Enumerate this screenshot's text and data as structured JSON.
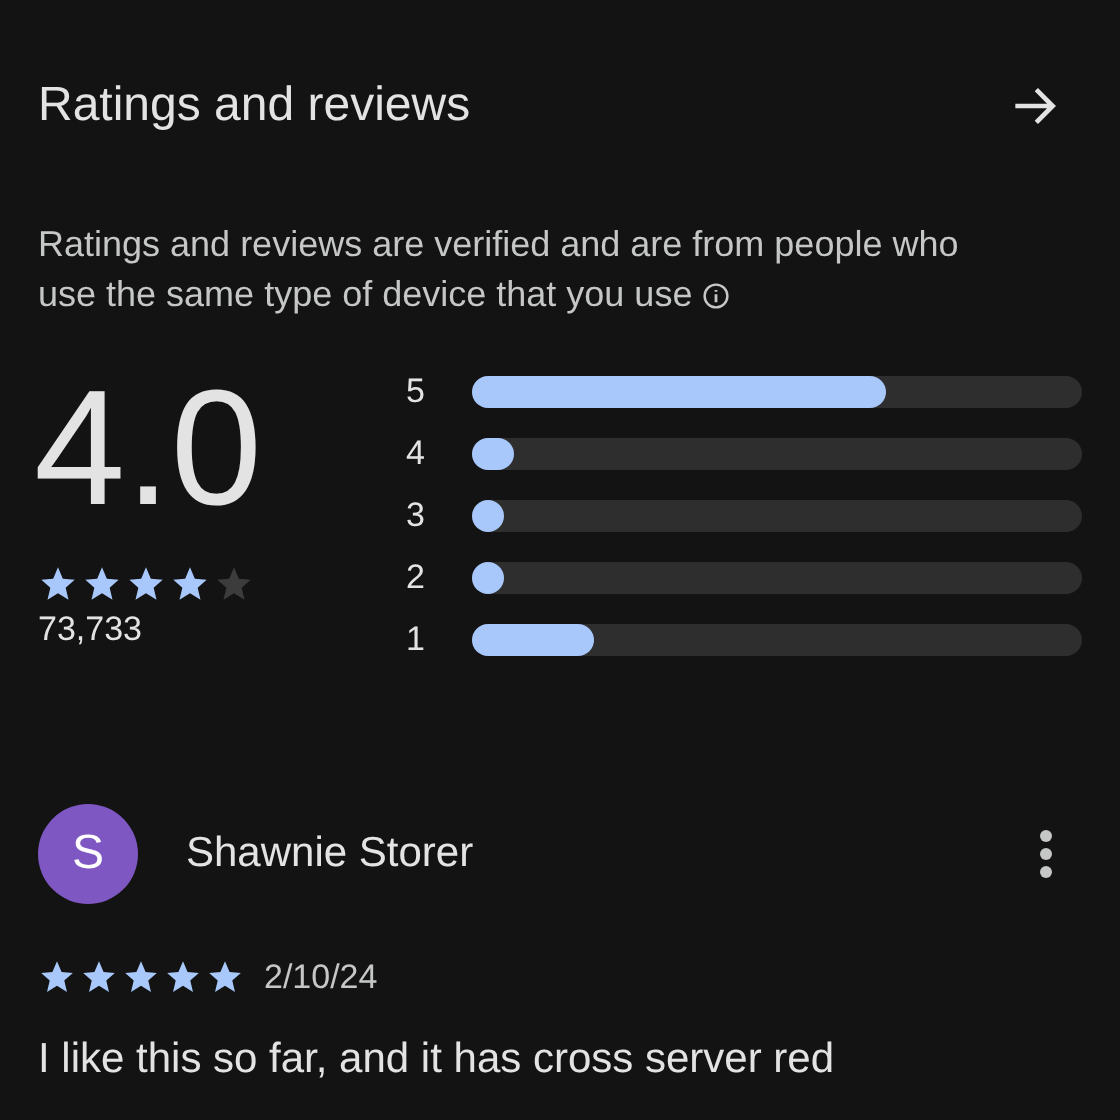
{
  "header": {
    "title": "Ratings and reviews"
  },
  "notice": [
    "Ratings and reviews are verified and are from people who",
    "use the same type of device that you use"
  ],
  "summary": {
    "score": "4.0",
    "stars": 4,
    "count": "73,733"
  },
  "distribution": [
    {
      "label": "5",
      "level": 0.68
    },
    {
      "label": "4",
      "level": 0.07
    },
    {
      "label": "3",
      "level": 0.03
    },
    {
      "label": "2",
      "level": 0.03
    },
    {
      "label": "1",
      "level": 0.2
    }
  ],
  "reviews": [
    {
      "initial": "S",
      "color": "#7e57c2",
      "name": "Shawnie Storer",
      "stars": 5,
      "date": "2/10/24",
      "text": "I like this so far, and it has cross server red"
    }
  ]
}
